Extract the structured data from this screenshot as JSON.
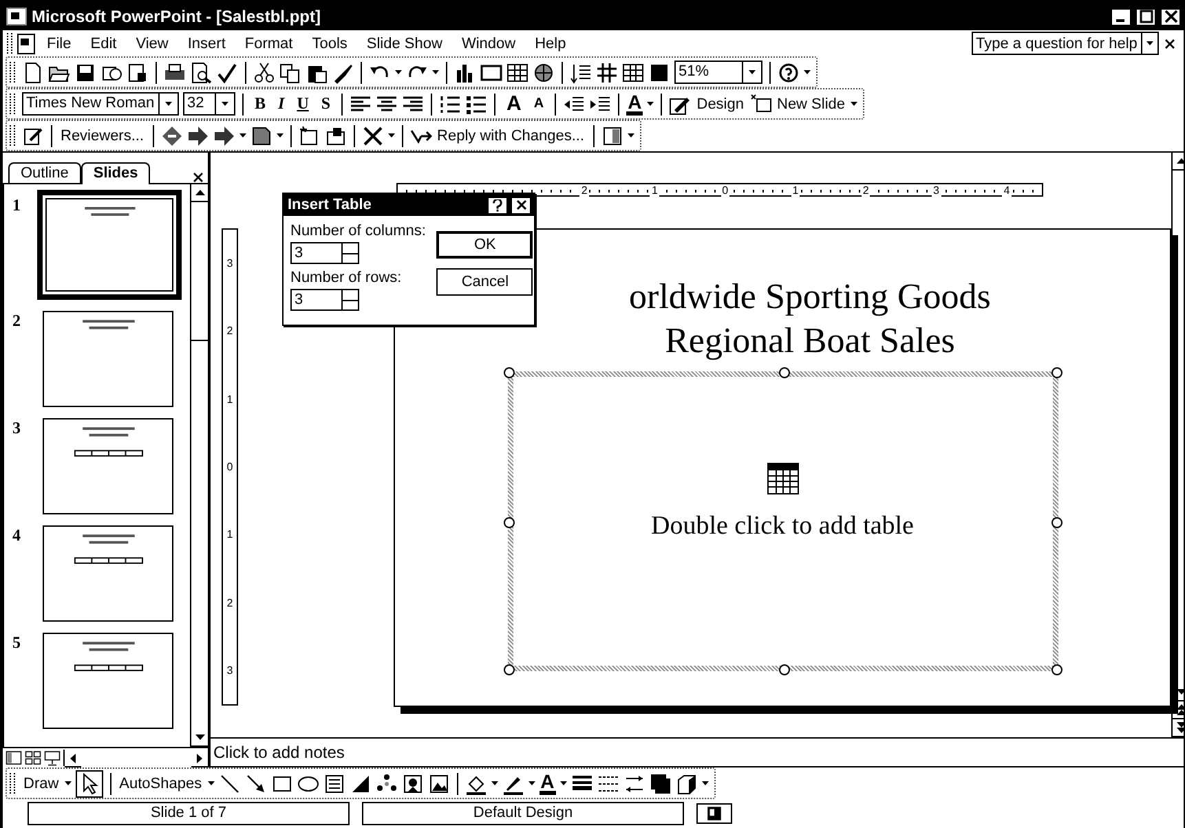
{
  "window": {
    "title": "Microsoft PowerPoint - [Salestbl.ppt]"
  },
  "menu": [
    "File",
    "Edit",
    "View",
    "Insert",
    "Format",
    "Tools",
    "Slide Show",
    "Window",
    "Help"
  ],
  "help_box": {
    "placeholder": "Type a question for help"
  },
  "standard_toolbar": {
    "zoom": "51%"
  },
  "formatting_toolbar": {
    "font": "Times New Roman",
    "size": "32",
    "styles": [
      "B",
      "I",
      "U",
      "S"
    ],
    "grow_font": "A",
    "shrink_font": "A",
    "font_color": "A",
    "design": "Design",
    "new_slide": "New Slide"
  },
  "reviewing_toolbar": {
    "reviewers": "Reviewers...",
    "reply": "Reply with Changes..."
  },
  "pane_tabs": [
    {
      "label": "Outline",
      "selected": false
    },
    {
      "label": "Slides",
      "selected": true
    }
  ],
  "thumbnails": [
    {
      "number": "1",
      "selected": true,
      "kind": "title"
    },
    {
      "number": "2",
      "selected": false,
      "kind": "title"
    },
    {
      "number": "3",
      "selected": false,
      "kind": "table"
    },
    {
      "number": "4",
      "selected": false,
      "kind": "table"
    },
    {
      "number": "5",
      "selected": false,
      "kind": "table"
    }
  ],
  "rulers": {
    "horizontal": [
      "2",
      "1",
      "0",
      "1",
      "2",
      "3",
      "4"
    ],
    "vertical": [
      "3",
      "2",
      "1",
      "0",
      "1",
      "2",
      "3"
    ]
  },
  "slide": {
    "title_lines": [
      "orldwide Sporting Goods",
      "Regional Boat Sales"
    ],
    "placeholder": "Double click to add table"
  },
  "dialog": {
    "title": "Insert Table",
    "columns_label": "Number of columns:",
    "columns": "3",
    "rows_label": "Number of rows:",
    "rows": "3",
    "ok": "OK",
    "cancel": "Cancel"
  },
  "notes": {
    "placeholder": "Click to add notes"
  },
  "drawing_toolbar": {
    "draw": "Draw",
    "autoshapes": "AutoShapes",
    "font_color": "A"
  },
  "status_bar": [
    "Slide 1 of 7",
    "Default Design"
  ]
}
